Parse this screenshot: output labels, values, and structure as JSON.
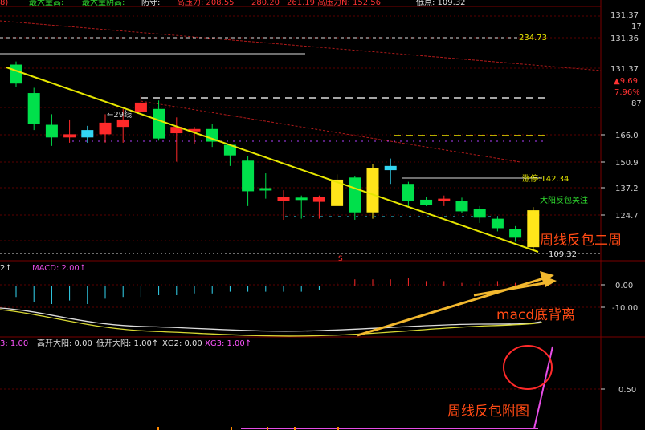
{
  "colors": {
    "background": "#000000",
    "border": "#7a0000",
    "up_candle": "#ff2a2a",
    "down_candle": "#00e04b",
    "special_candle": "#ffe51a",
    "cyan_candle": "#33d6f2",
    "trendline": "#e6e600",
    "annotation": "#ff4a14",
    "arrow": "#f2b82e",
    "macd_line_white": "#dcdcdc",
    "macd_line_yellow": "#d9d933",
    "signal_line": "#e64de6"
  },
  "header": {
    "items": [
      {
        "label": "8)",
        "color": "#ff3333"
      },
      {
        "label": "最大量高:",
        "color": "#2fdc2f"
      },
      {
        "label": "最大量阴高:",
        "color": "#2fdc2f"
      },
      {
        "label": "防守:",
        "color": "#e0e0e0"
      },
      {
        "label": "高压力: 208.55",
        "color": "#ff3333"
      },
      {
        "label": "280.20",
        "color": "#ff3333"
      },
      {
        "label": "261.19",
        "color": "#ff3333"
      },
      {
        "label": "高压力N: 152.56",
        "color": "#ff3333"
      },
      {
        "label": "低点: 109.32",
        "color": "#e0e0e0"
      }
    ]
  },
  "right_axis": {
    "labels": [
      "131.37",
      "17",
      "131.36",
      "131.37",
      "▲9.69",
      "7.96%",
      "87",
      "166.0",
      "150.9",
      "137.2",
      "124.7"
    ]
  },
  "main_annotations": {
    "line_label": "234.73",
    "price_line_label": "←29线",
    "zt_label": "涨停:142.34",
    "big_yang_label": "大阳反包关注",
    "low_label": "109.32",
    "s_marker": "S",
    "weekly_text": "周线反包二周"
  },
  "macd_panel": {
    "header_prefix": "2↑",
    "header": "MACD: 2.00↑",
    "axis": [
      "0.00",
      "-10.00"
    ],
    "annotation": "macd底背离"
  },
  "signal_panel": {
    "header": [
      {
        "label": "3: 1.00",
        "color": "#ff55ff"
      },
      {
        "label": "高开大阳: 0.00",
        "color": "#e0e0e0"
      },
      {
        "label": "低开大阳: 1.00↑",
        "color": "#e0e0e0"
      },
      {
        "label": "XG2: 0.00",
        "color": "#e0e0e0"
      },
      {
        "label": "XG3: 1.00↑",
        "color": "#ff55ff"
      }
    ],
    "axis": [
      "0.50"
    ],
    "annotation": "周线反包附图"
  },
  "chart_data": {
    "type": "candlestick",
    "candles": [
      {
        "o": 252,
        "h": 255,
        "l": 231,
        "c": 234,
        "color": "down"
      },
      {
        "o": 225,
        "h": 230,
        "l": 190,
        "c": 196,
        "color": "down"
      },
      {
        "o": 195,
        "h": 205,
        "l": 175,
        "c": 183,
        "color": "down"
      },
      {
        "o": 183,
        "h": 200,
        "l": 178,
        "c": 186,
        "color": "up"
      },
      {
        "o": 183,
        "h": 194,
        "l": 178,
        "c": 190,
        "color": "cyan"
      },
      {
        "o": 186,
        "h": 205,
        "l": 178,
        "c": 197,
        "color": "up"
      },
      {
        "o": 193,
        "h": 210,
        "l": 178,
        "c": 200,
        "color": "up"
      },
      {
        "o": 207,
        "h": 223,
        "l": 200,
        "c": 216,
        "color": "up"
      },
      {
        "o": 210,
        "h": 218,
        "l": 180,
        "c": 182,
        "color": "down"
      },
      {
        "o": 187,
        "h": 202,
        "l": 160,
        "c": 193,
        "color": "up"
      },
      {
        "o": 190,
        "h": 193,
        "l": 177,
        "c": 191,
        "color": "up"
      },
      {
        "o": 191,
        "h": 196,
        "l": 174,
        "c": 179,
        "color": "down"
      },
      {
        "o": 166,
        "h": 172,
        "l": 156,
        "c": 176,
        "color": "down"
      },
      {
        "o": 161,
        "h": 165,
        "l": 118,
        "c": 132,
        "color": "down"
      },
      {
        "o": 135,
        "h": 149,
        "l": 125,
        "c": 135,
        "color": "down"
      },
      {
        "o": 123,
        "h": 133,
        "l": 105,
        "c": 127,
        "color": "up"
      },
      {
        "o": 126,
        "h": 128,
        "l": 106,
        "c": 124,
        "color": "down"
      },
      {
        "o": 122,
        "h": 128,
        "l": 106,
        "c": 127,
        "color": "up"
      },
      {
        "o": 143,
        "h": 148,
        "l": 122,
        "c": 118,
        "color": "yellow"
      },
      {
        "o": 145,
        "h": 146,
        "l": 105,
        "c": 112,
        "color": "down"
      },
      {
        "o": 154,
        "h": 158,
        "l": 106,
        "c": 112,
        "color": "yellow"
      },
      {
        "o": 152,
        "h": 163,
        "l": 139,
        "c": 156,
        "color": "cyan"
      },
      {
        "o": 139,
        "h": 141,
        "l": 118,
        "c": 123,
        "color": "down"
      },
      {
        "o": 124,
        "h": 127,
        "l": 118,
        "c": 119,
        "color": "down"
      },
      {
        "o": 123,
        "h": 128,
        "l": 118,
        "c": 125,
        "color": "up"
      },
      {
        "o": 123,
        "h": 126,
        "l": 111,
        "c": 113,
        "color": "down"
      },
      {
        "o": 115,
        "h": 118,
        "l": 102,
        "c": 107,
        "color": "down"
      },
      {
        "o": 106,
        "h": 108,
        "l": 94,
        "c": 97,
        "color": "down"
      },
      {
        "o": 96,
        "h": 99,
        "l": 84,
        "c": 88,
        "color": "down"
      },
      {
        "o": 79,
        "h": 117,
        "l": 76,
        "c": 114,
        "color": "yellow"
      }
    ],
    "macd_hist": [
      0.6,
      0.9,
      1.0,
      0.8,
      1.0,
      0.7,
      0.6,
      0.6,
      0.5,
      0.5,
      0.4,
      0.4,
      0.3,
      0.3,
      0.3,
      0.3,
      0.3,
      0.2,
      -0.2,
      -0.4,
      -0.4,
      -0.4,
      -0.5,
      -0.3,
      -0.3,
      -0.2,
      -0.3,
      -0.3,
      -0.2,
      -0.2
    ]
  }
}
